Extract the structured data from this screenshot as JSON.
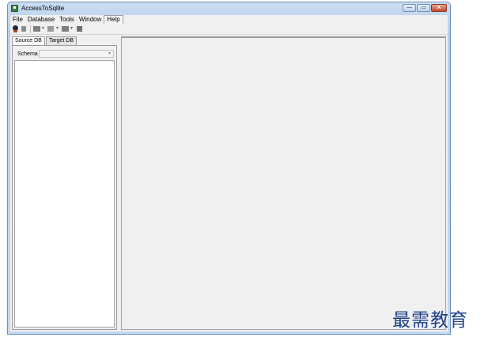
{
  "window": {
    "title": "AccessToSqlite"
  },
  "window_buttons": {
    "minimize": "—",
    "maximize": "▭",
    "close": "✕"
  },
  "menu": {
    "items": [
      "File",
      "Database",
      "Tools",
      "Window",
      "Help"
    ]
  },
  "left_panel": {
    "tabs": [
      "Source DB",
      "Target DB"
    ],
    "schema_label": "Schema",
    "schema_value": ""
  },
  "watermark": {
    "text": "最需教育"
  },
  "icons": {
    "app": "app-icon",
    "toolbar": [
      "connect-icon",
      "disconnect-icon",
      "table-icon",
      "dropdown-icon",
      "view-icon",
      "dropdown-icon",
      "export-icon",
      "dropdown-icon",
      "grid-icon"
    ]
  },
  "colors": {
    "title_bar": "#b7cfee",
    "close_button": "#c9452c",
    "watermark": "#1e3f8a"
  }
}
